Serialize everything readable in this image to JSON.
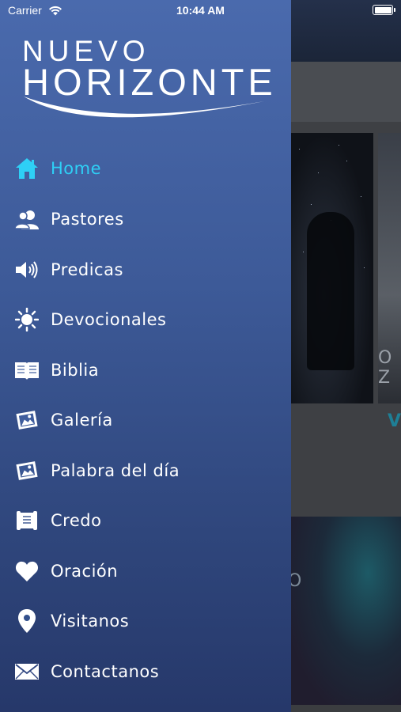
{
  "status_bar": {
    "carrier": "Carrier",
    "time": "10:44 AM"
  },
  "logo": {
    "line1": "NUEVO",
    "line2": "HORIZONTE"
  },
  "menu": {
    "items": [
      {
        "label": "Home",
        "icon": "home-icon",
        "active": true
      },
      {
        "label": "Pastores",
        "icon": "people-icon"
      },
      {
        "label": "Predicas",
        "icon": "speaker-icon"
      },
      {
        "label": "Devocionales",
        "icon": "sun-icon"
      },
      {
        "label": "Biblia",
        "icon": "book-icon"
      },
      {
        "label": "Galería",
        "icon": "photo-icon"
      },
      {
        "label": "Palabra del día",
        "icon": "photo-icon"
      },
      {
        "label": "Credo",
        "icon": "scroll-icon"
      },
      {
        "label": "Oración",
        "icon": "heart-icon"
      },
      {
        "label": "Visitanos",
        "icon": "location-pin-icon"
      },
      {
        "label": "Contactanos",
        "icon": "envelope-icon"
      }
    ]
  },
  "colors": {
    "accent": "#2ed0f6",
    "drawer_top": "#4a6aad",
    "drawer_bottom": "#26386a"
  }
}
